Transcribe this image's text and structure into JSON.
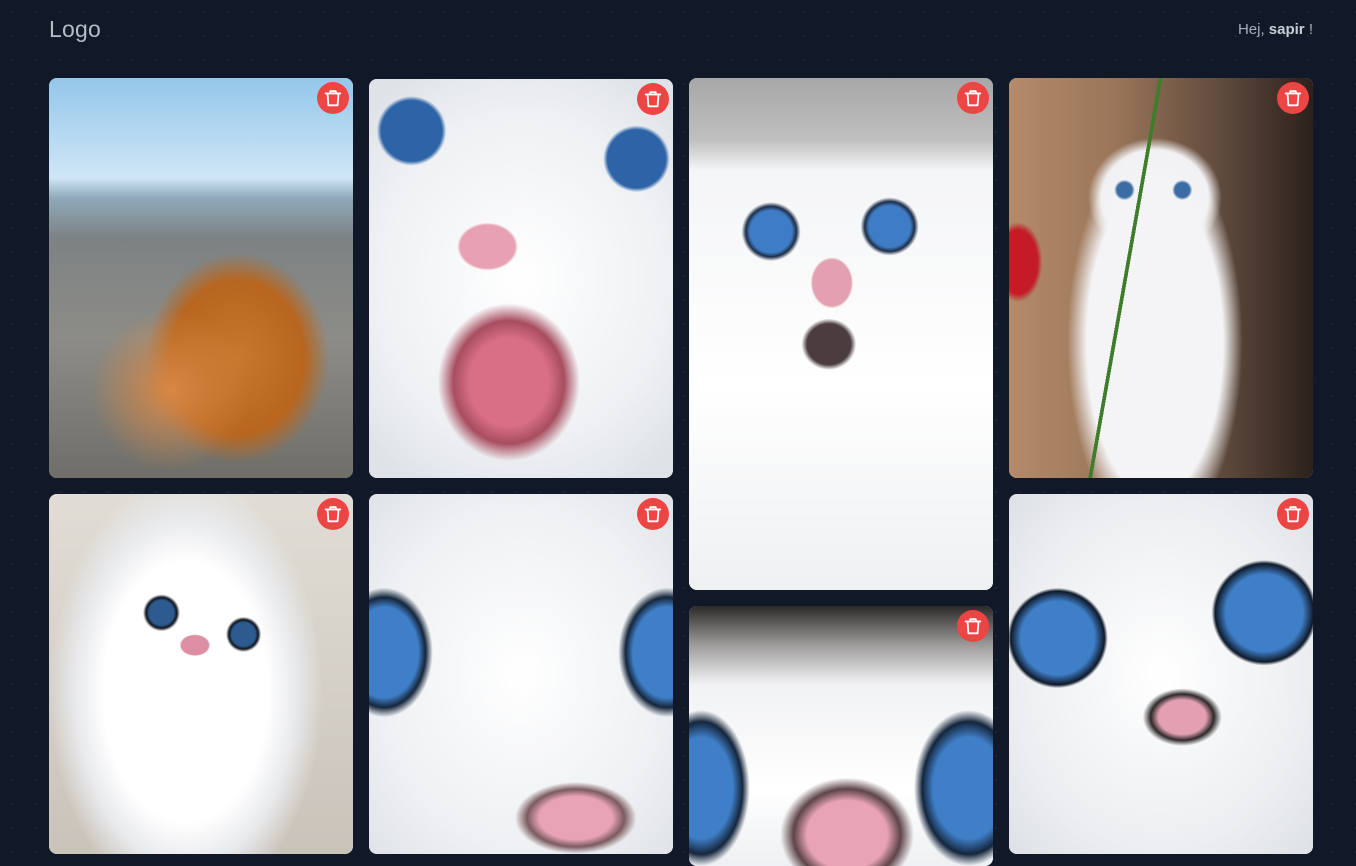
{
  "header": {
    "logo": "Logo",
    "greeting_prefix": "Hej, ",
    "user_name": "sapir",
    "greeting_suffix": " !"
  },
  "gallery": {
    "delete_icon": "trash-icon",
    "delete_color": "#ef4444",
    "cards": [
      {
        "subject": "ginger-cat-beach-photo"
      },
      {
        "subject": "white-cat-open-mouth-photo"
      },
      {
        "subject": "white-cat-blue-eyes-photo"
      },
      {
        "subject": "white-cat-with-rose-photo"
      },
      {
        "subject": "white-cat-looking-up-photo"
      },
      {
        "subject": "white-cat-closeup-photo"
      },
      {
        "subject": "white-cat-nose-closeup-photo"
      },
      {
        "subject": "white-cat-blue-eyes-closeup-photo"
      }
    ]
  },
  "colors": {
    "background": "#111827",
    "delete_button": "#ef4444"
  }
}
